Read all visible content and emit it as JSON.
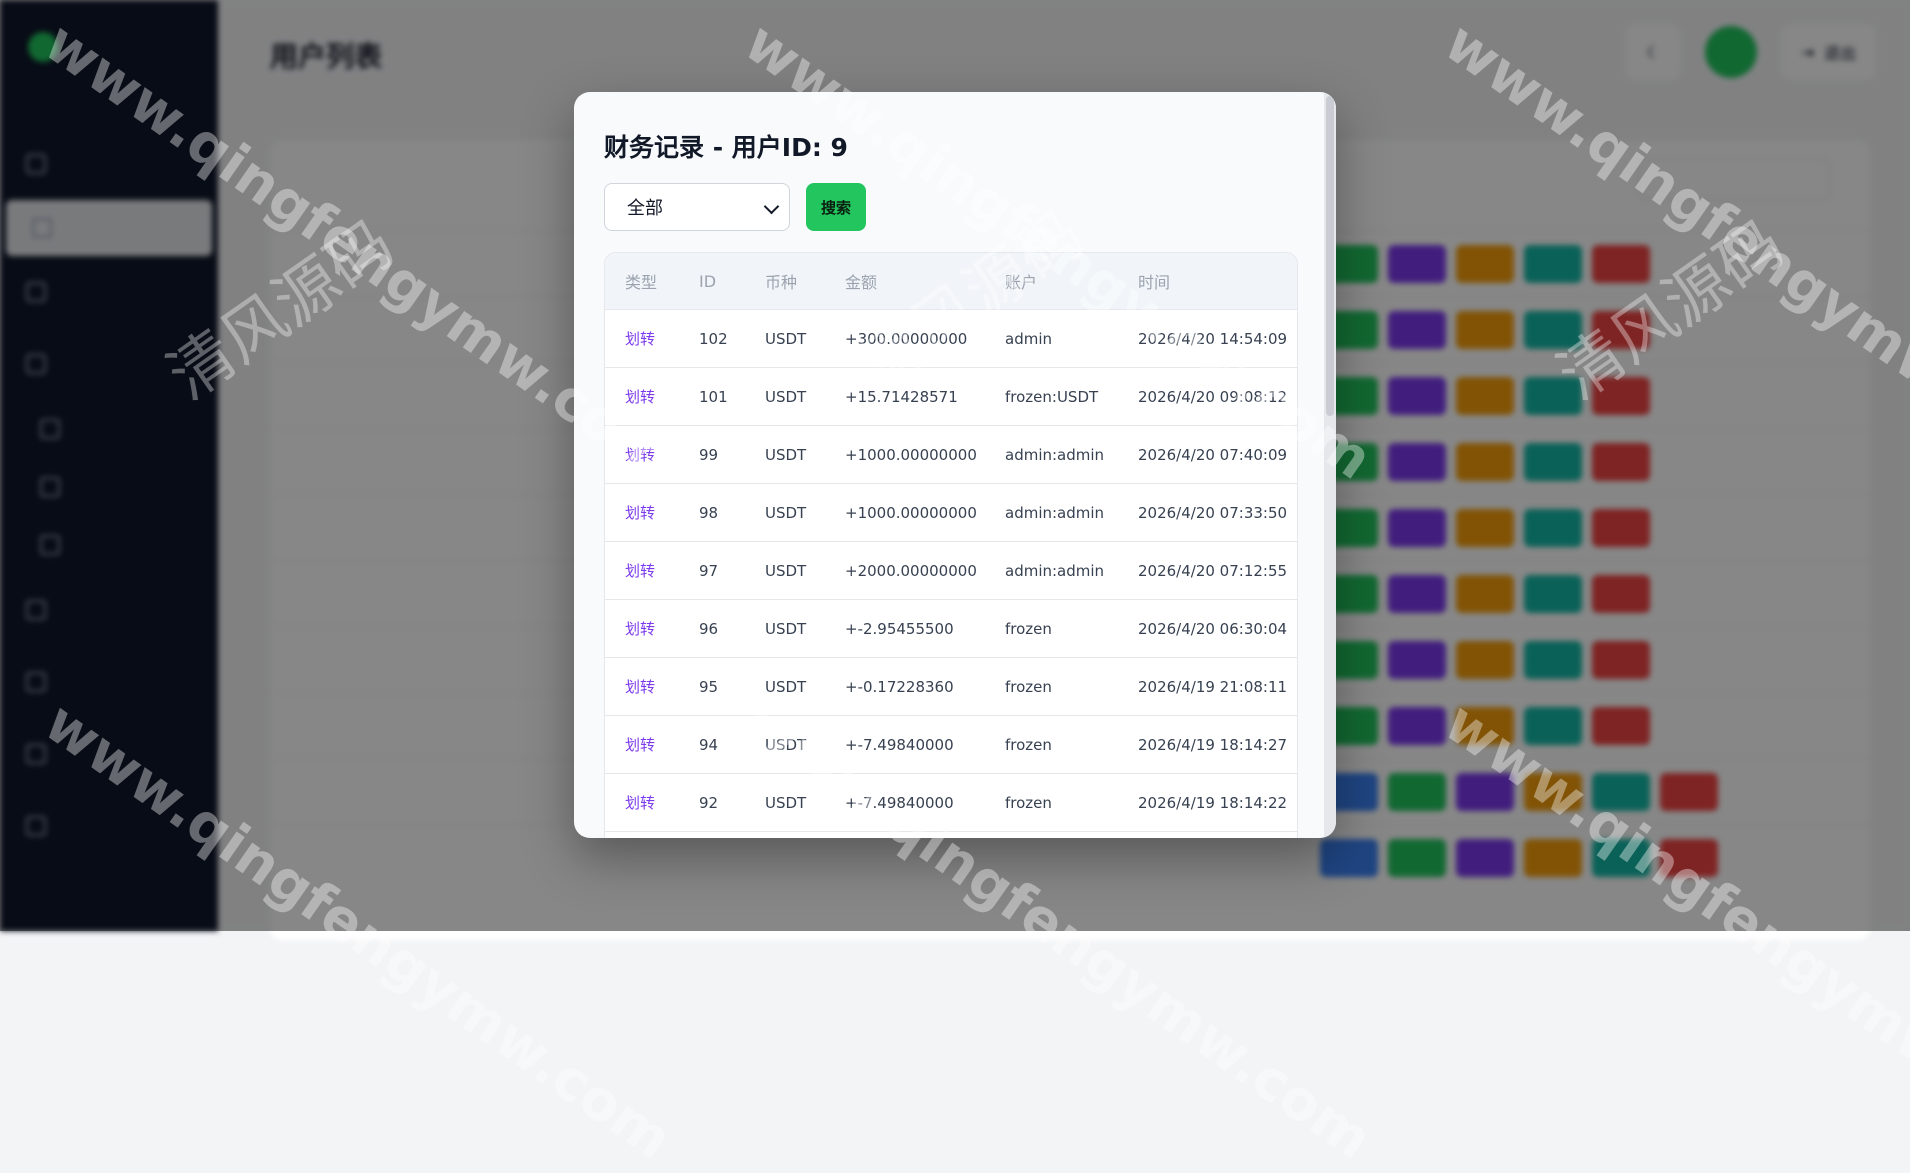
{
  "background_app": {
    "page_title": "用户列表",
    "top_actions": [
      "退出"
    ]
  },
  "modal": {
    "title": "财务记录 - 用户ID: 9",
    "filter_value": "全部",
    "search_label": "搜索",
    "columns": [
      "类型",
      "ID",
      "币种",
      "金额",
      "账户",
      "时间"
    ],
    "rows": [
      {
        "type": "划转",
        "id": "102",
        "currency": "USDT",
        "amount": "+300.00000000",
        "account": "admin",
        "time": "2026/4/20 14:54:09"
      },
      {
        "type": "划转",
        "id": "101",
        "currency": "USDT",
        "amount": "+15.71428571",
        "account": "frozen:USDT",
        "time": "2026/4/20 09:08:12"
      },
      {
        "type": "划转",
        "id": "99",
        "currency": "USDT",
        "amount": "+1000.00000000",
        "account": "admin:admin",
        "time": "2026/4/20 07:40:09"
      },
      {
        "type": "划转",
        "id": "98",
        "currency": "USDT",
        "amount": "+1000.00000000",
        "account": "admin:admin",
        "time": "2026/4/20 07:33:50"
      },
      {
        "type": "划转",
        "id": "97",
        "currency": "USDT",
        "amount": "+2000.00000000",
        "account": "admin:admin",
        "time": "2026/4/20 07:12:55"
      },
      {
        "type": "划转",
        "id": "96",
        "currency": "USDT",
        "amount": "+-2.95455500",
        "account": "frozen",
        "time": "2026/4/20 06:30:04"
      },
      {
        "type": "划转",
        "id": "95",
        "currency": "USDT",
        "amount": "+-0.17228360",
        "account": "frozen",
        "time": "2026/4/19 21:08:11"
      },
      {
        "type": "划转",
        "id": "94",
        "currency": "USDT",
        "amount": "+-7.49840000",
        "account": "frozen",
        "time": "2026/4/19 18:14:27"
      },
      {
        "type": "划转",
        "id": "92",
        "currency": "USDT",
        "amount": "+-7.49840000",
        "account": "frozen",
        "time": "2026/4/19 18:14:22"
      }
    ]
  },
  "watermark": {
    "url": "www.qingfengymw.com",
    "cn": "清风源码"
  },
  "colors": {
    "accent_green": "#22c55e",
    "link_purple": "#7c3aed",
    "sidebar": "#0f172a"
  }
}
